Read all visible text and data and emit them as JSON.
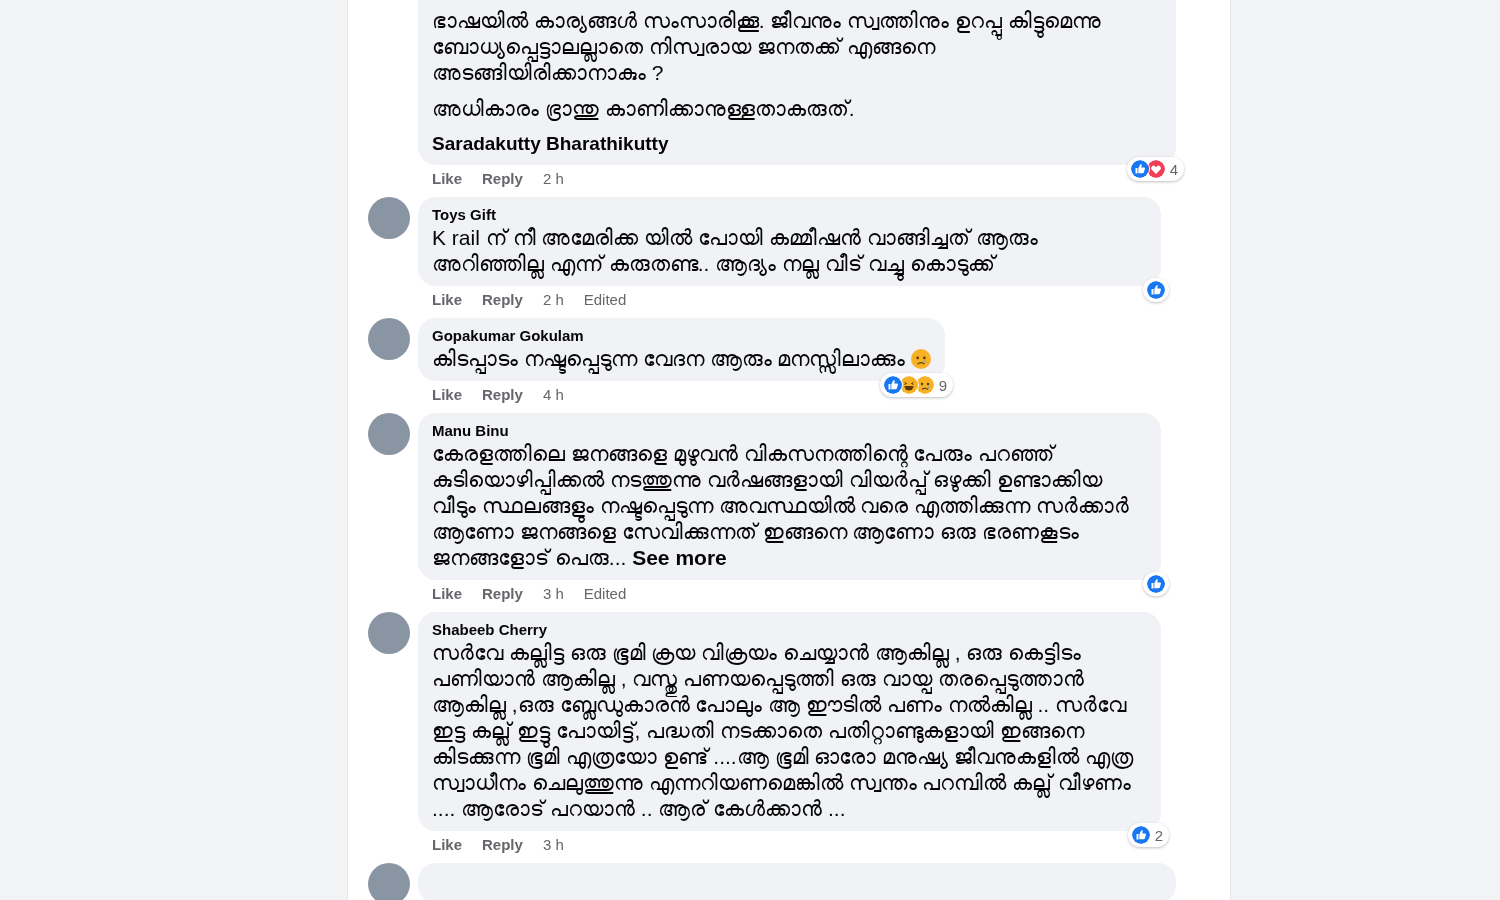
{
  "comments": [
    {
      "kind": "continued",
      "paragraphs": [
        "ഭാഷയിൽ കാര്യങ്ങൾ സംസാരിക്കൂ. ജീവനും സ്വത്തിനും ഉറപ്പു കിട്ടുമെന്നു ബോധ്യപ്പെട്ടാലല്ലാതെ നിസ്വരായ ജനതക്ക് എങ്ങനെ അടങ്ങിയിരിക്കാനാകും ?",
        "അധികാരം ഭ്രാന്തു കാണിക്കാനുള്ളതാകരുത്."
      ],
      "signature": "Saradakutty Bharathikutty",
      "actions": [
        "Like",
        "Reply"
      ],
      "time": "2 h",
      "reactions": [
        {
          "kind": "like"
        },
        {
          "kind": "love"
        }
      ],
      "reaction_count": "4"
    },
    {
      "kind": "full",
      "author": "Toys Gift",
      "paragraphs": [
        "K rail ന് നീ അമേരിക്ക യിൽ പോയി കമ്മീഷൻ വാങ്ങിച്ചത് ആരും അറിഞ്ഞില്ല എന്ന് കരുതണ്ട.. ആദ്യം നല്ല വീട് വച്ചു കൊടുക്ക്"
      ],
      "actions": [
        "Like",
        "Reply"
      ],
      "time": "2 h",
      "edited": "Edited",
      "reactions": [
        {
          "kind": "like"
        }
      ]
    },
    {
      "kind": "full",
      "author": "Gopakumar Gokulam",
      "paragraphs": [
        "കിടപ്പാടം നഷ്ടപ്പെടുന്ന വേദന ആരും മനസ്സിലാക്കും"
      ],
      "emoji": {
        "kind": "sad"
      },
      "actions": [
        "Like",
        "Reply"
      ],
      "time": "4 h",
      "reactions": [
        {
          "kind": "like"
        },
        {
          "kind": "haha"
        },
        {
          "kind": "sad"
        }
      ],
      "reaction_count": "9"
    },
    {
      "kind": "full",
      "author": "Manu Binu",
      "paragraphs": [
        "കേരളത്തിലെ ജനങ്ങളെ മുഴുവൻ വികസനത്തിന്റെ പേരും പറഞ്ഞ് കുടിയൊഴിപ്പിക്കൽ നടത്തുന്നു വർഷങ്ങളായി വിയർപ്പ് ഒഴുക്കി ഉണ്ടാക്കിയ വീടും സ്ഥലങ്ങളും നഷ്ടപ്പെടുന്ന അവസ്ഥയിൽ വരെ എത്തിക്കുന്ന സർക്കാർ ആണോ ജനങ്ങളെ സേവിക്കുന്നത് ഇങ്ങനെ ആണോ ഒരു ഭരണകൂടം ജനങ്ങളോട് പെരു..."
      ],
      "see_more": "See more",
      "actions": [
        "Like",
        "Reply"
      ],
      "time": "3 h",
      "edited": "Edited",
      "reactions": [
        {
          "kind": "like"
        }
      ]
    },
    {
      "kind": "full",
      "author": "Shabeeb Cherry",
      "paragraphs": [
        "സർവേ കല്ലിട്ട ഒരു ഭൂമി ക്രയ വിക്രയം ചെയ്യാൻ ആകില്ല , ഒരു കെട്ടിടം പണിയാൻ ആകില്ല , വസ്തു പണയപ്പെടുത്തി ഒരു വായ്പ തരപ്പെടുത്താൻ ആകില്ല ,ഒരു ബ്ലേഡുകാരൻ പോലും ആ ഈടിൽ പണം നൽകില്ല .. സർവേ ഇട്ട കല്ല് ഇട്ടു പോയിട്ട്, പദ്ധതി നടക്കാതെ പതിറ്റാണ്ടുകളായി ഇങ്ങനെ കിടക്കുന്ന ഭൂമി എത്രയോ ഉണ്ട് ....ആ ഭൂമി ഓരോ മനുഷ്യ ജീവനുകളിൽ എത്ര സ്വാധീനം ചെലുത്തുന്നു എന്നറിയണമെങ്കിൽ സ്വന്തം പറമ്പിൽ കല്ല് വീഴണം .... ആരോട് പറയാൻ .. ആര് കേൾക്കാൻ ..."
      ],
      "actions": [
        "Like",
        "Reply"
      ],
      "time": "3 h",
      "reactions": [
        {
          "kind": "like"
        }
      ],
      "reaction_count": "2"
    },
    {
      "kind": "cut"
    }
  ]
}
